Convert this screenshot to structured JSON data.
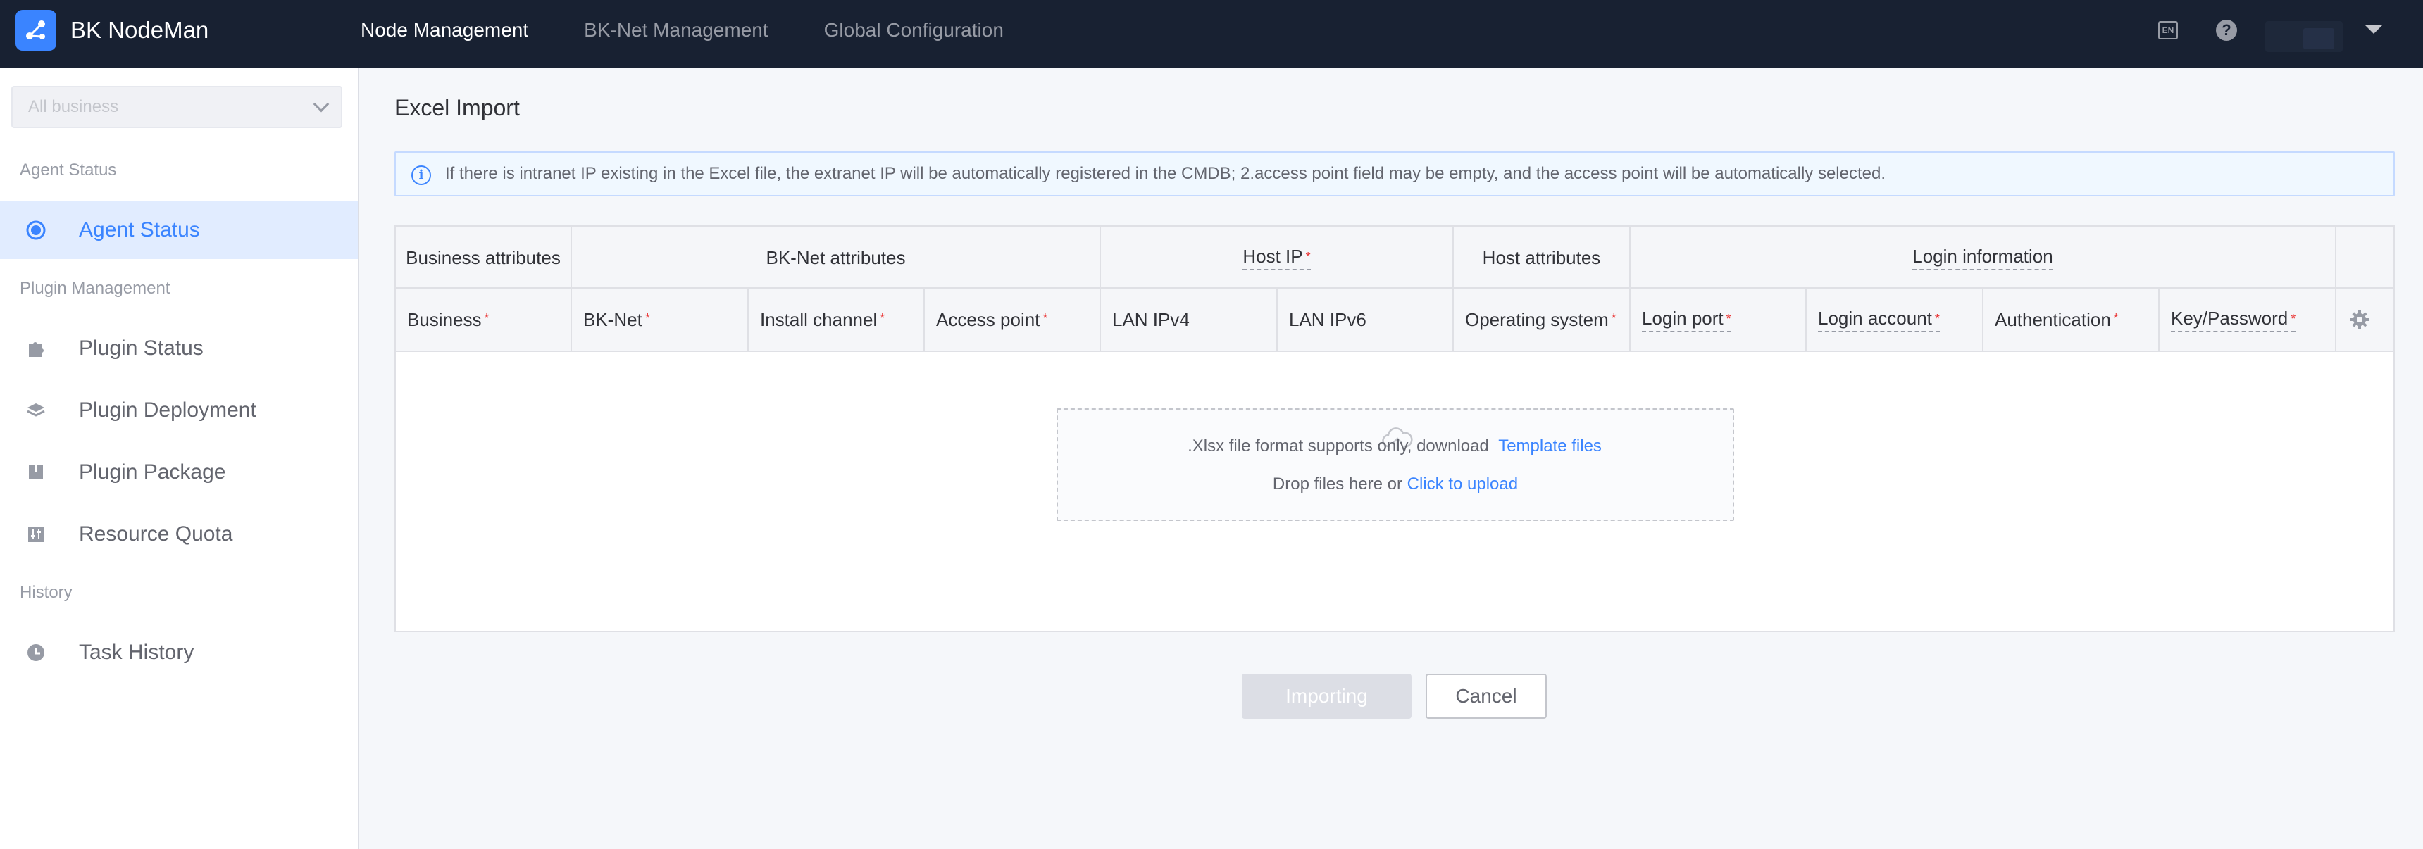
{
  "app": {
    "title": "BK NodeMan"
  },
  "topnav": {
    "items": [
      "Node Management",
      "BK-Net Management",
      "Global Configuration"
    ],
    "active_index": 0
  },
  "header_right": {
    "lang_label": "EN",
    "help_icon": "help-circle-icon"
  },
  "sidebar": {
    "business_select": {
      "value": "All business"
    },
    "groups": [
      {
        "title": "Agent Status",
        "items": [
          {
            "label": "Agent Status",
            "icon": "radio-dot-icon",
            "active": true
          }
        ]
      },
      {
        "title": "Plugin Management",
        "items": [
          {
            "label": "Plugin Status",
            "icon": "puzzle-icon"
          },
          {
            "label": "Plugin Deployment",
            "icon": "layers-icon"
          },
          {
            "label": "Plugin Package",
            "icon": "package-icon"
          },
          {
            "label": "Resource Quota",
            "icon": "sliders-icon"
          }
        ]
      },
      {
        "title": "History",
        "items": [
          {
            "label": "Task History",
            "icon": "clock-icon"
          }
        ]
      }
    ]
  },
  "main": {
    "title": "Excel Import",
    "alert": "If there is intranet IP existing in the Excel file, the extranet IP will be automatically registered in the CMDB; 2.access point field may be empty, and the access point will be automatically selected.",
    "table": {
      "groups": [
        "Business attributes",
        "BK-Net attributes",
        "Host IP",
        "Host attributes",
        "Login information"
      ],
      "columns": [
        "Business",
        "BK-Net",
        "Install channel",
        "Access point",
        "LAN IPv4",
        "LAN IPv6",
        "Operating system",
        "Login port",
        "Login account",
        "Authentication",
        "Key/Password"
      ]
    },
    "upload": {
      "drop_text": "Drop files here or",
      "click_text": "Click to upload",
      "tip_text": ".Xlsx file format supports only, download",
      "template_link": "Template files"
    },
    "buttons": {
      "import": "Importing",
      "cancel": "Cancel"
    }
  },
  "colors": {
    "accent": "#3a84ff",
    "topbar": "#182132",
    "required": "#ea3636"
  }
}
